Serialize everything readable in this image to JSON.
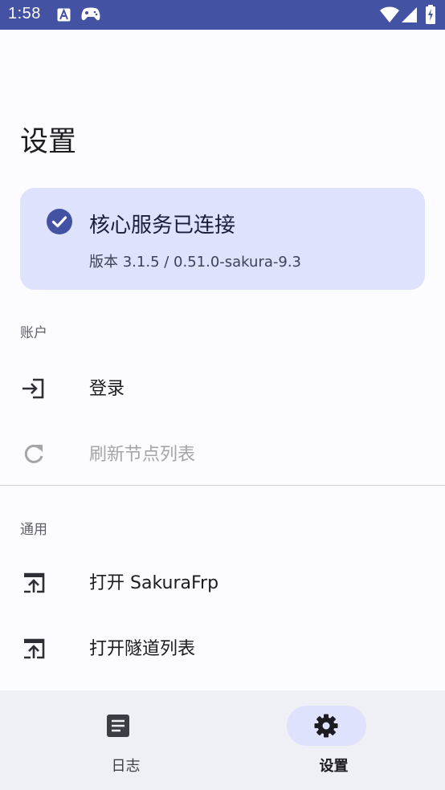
{
  "status_bar": {
    "time": "1:58"
  },
  "page": {
    "title": "设置"
  },
  "core_status": {
    "title": "核心服务已连接",
    "version": "版本 3.1.5 / 0.51.0-sakura-9.3"
  },
  "sections": {
    "account": {
      "label": "账户",
      "items": [
        {
          "label": "登录",
          "icon": "login-icon"
        },
        {
          "label": "刷新节点列表",
          "icon": "refresh-icon"
        }
      ]
    },
    "general": {
      "label": "通用",
      "items": [
        {
          "label": "打开 SakuraFrp",
          "icon": "open-in-browser-icon"
        },
        {
          "label": "打开隧道列表",
          "icon": "open-in-browser-icon"
        }
      ]
    }
  },
  "bottom_nav": {
    "items": [
      {
        "label": "日志",
        "icon": "log-icon"
      },
      {
        "label": "设置",
        "icon": "gear-icon"
      }
    ],
    "active": "设置"
  },
  "colors": {
    "status_bar": "#4452a3",
    "accent": "#4452a3",
    "card_bg": "#dee2fc"
  }
}
